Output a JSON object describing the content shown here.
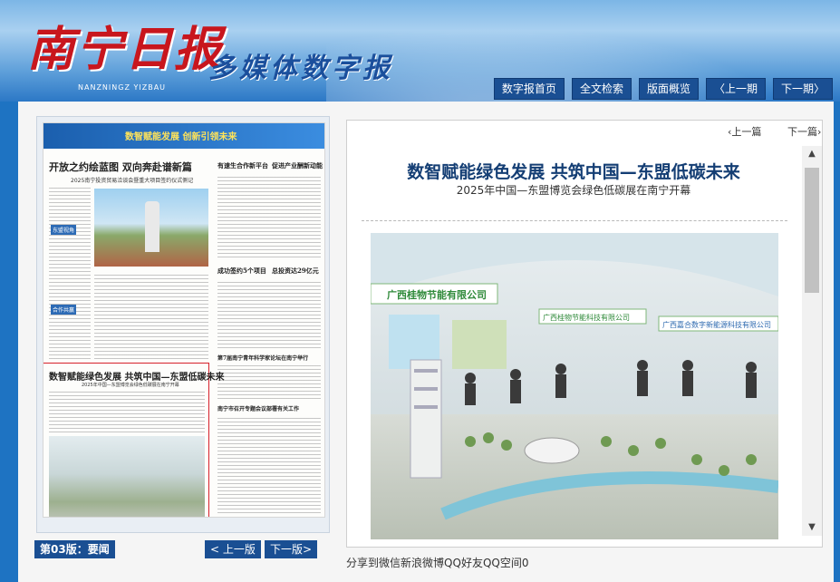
{
  "header": {
    "logo": "南宁日报",
    "subtitle": "多媒体数字报",
    "pinyin": "NANZNINGZ YIZBAU"
  },
  "nav": {
    "items": [
      "数字报首页",
      "全文检索",
      "版面概览",
      "〈上一期",
      "下一期〉"
    ]
  },
  "thumbnail": {
    "banner_text": "数智赋能发展 创新引领未来",
    "headline": "开放之约绘蓝图 双向奔赴谱新篇",
    "sub": "2025南宁投资贸易洽谈会暨重大项目签约仪式侧记",
    "side_heading_1": "有速生合作新平台",
    "side_heading_2": "促进产业酬新动能",
    "mark_1": "东盟视角",
    "mark_2": "合作共赢",
    "mid_heading_1": "成功签约5个项目",
    "mid_heading_2": "总投资达29亿元",
    "right_heading_3": "第7届南宁青年科学家论坛在南宁举行",
    "right_heading_4": "南宁市召开专题会议部署有关工作",
    "selected_head": "数智赋能绿色发展 共筑中国—东盟低碳未来",
    "selected_sub": "2025年中国—东盟博览会绿色低碳展在南宁开幕"
  },
  "page_nav": {
    "label": "第03版：要闻",
    "prev": "< 上一版",
    "next": "下一版>"
  },
  "article": {
    "prev": "上一篇",
    "next": "下一篇",
    "title": "数智赋能绿色发展 共筑中国—东盟低碳未来",
    "subtitle": "2025年中国—东盟博览会绿色低碳展在南宁开幕",
    "photo_sign_1": "广西桂物节能有限公司",
    "photo_sign_2": "广西桂物节能科技有限公司",
    "photo_sign_3": "广西嘉合数字新能源科技有限公司"
  },
  "share": {
    "prefix": "分享到",
    "items": [
      "微信",
      "新浪微博",
      "QQ好友",
      "QQ空间"
    ],
    "count": "0"
  },
  "colors": {
    "nav_bg": "#1a4f93",
    "title_color": "#143e74",
    "logo_red": "#c8161d",
    "selection_border": "#d6202a"
  }
}
